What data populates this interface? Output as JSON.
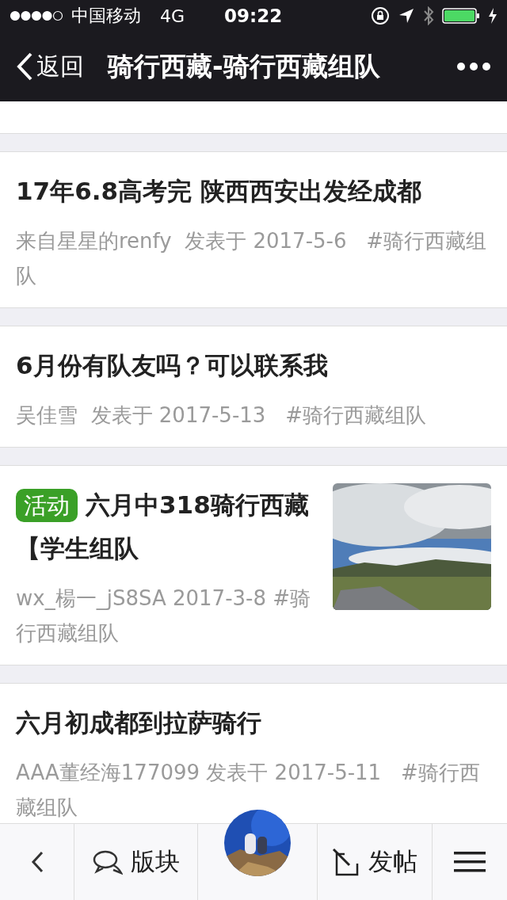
{
  "status_bar": {
    "carrier": "中国移动",
    "network": "4G",
    "time": "09:22"
  },
  "nav": {
    "back": "返回",
    "title": "骑行西藏-骑行西藏组队"
  },
  "posts": [
    {
      "title": "17年6.8高考完 陕西西安出发经成都",
      "meta": "来自星星的renfy  发表于 2017-5-6   #骑行西藏组队"
    },
    {
      "title": "6月份有队友吗？可以联系我",
      "meta": "吴佳雪  发表于 2017-5-13   #骑行西藏组队"
    },
    {
      "badge": "活动",
      "title": "六月中318骑行西藏【学生组队",
      "meta": "wx_楊一_jS8SA 2017-3-8 #骑行西藏组队"
    },
    {
      "title": "六月初成都到拉萨骑行",
      "meta": "AAA董经海177099 发表干 2017-5-11   #骑行西藏组队"
    }
  ],
  "tab_bar": {
    "boards": "版块",
    "post": "发帖"
  }
}
